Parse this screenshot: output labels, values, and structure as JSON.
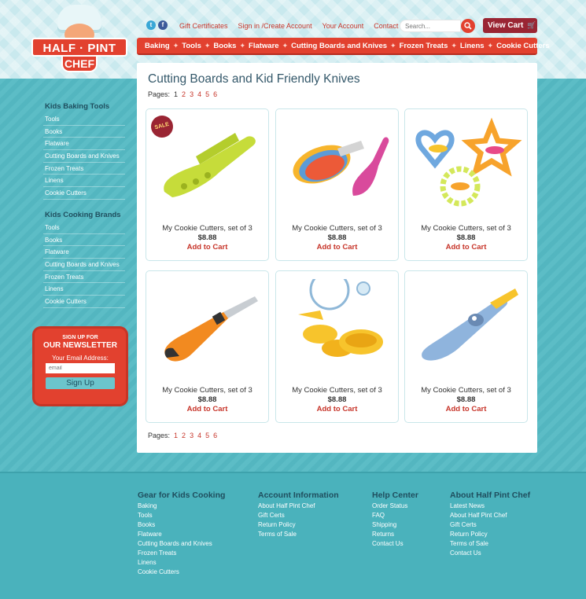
{
  "header": {
    "logo_line1": "HALF · PINT",
    "logo_line2": "CHEF",
    "social": {
      "twitter": "t",
      "facebook": "f"
    },
    "toplinks": [
      "Gift Certificates",
      "Sign in /Create Account",
      "Your Account",
      "Contact"
    ],
    "search_placeholder": "Search...",
    "cart_label": "View Cart"
  },
  "nav": [
    "Baking",
    "Tools",
    "Books",
    "Flatware",
    "Cutting Boards and Knives",
    "Frozen Treats",
    "Linens",
    "Cookie Cutters"
  ],
  "main": {
    "title": "Cutting Boards and Kid Friendly Knives",
    "pages_label": "Pages:",
    "pages": [
      "1",
      "2",
      "3",
      "4",
      "5",
      "6"
    ],
    "products": [
      {
        "name": "My Cookie Cutters, set of 3",
        "price": "$8.88",
        "add": "Add to Cart",
        "sale": "SALE"
      },
      {
        "name": "My Cookie Cutters, set of 3",
        "price": "$8.88",
        "add": "Add to Cart"
      },
      {
        "name": "My Cookie Cutters, set of 3",
        "price": "$8.88",
        "add": "Add to Cart"
      },
      {
        "name": "My Cookie Cutters, set of 3",
        "price": "$8.88",
        "add": "Add to Cart"
      },
      {
        "name": "My Cookie Cutters, set of 3",
        "price": "$8.88",
        "add": "Add to Cart"
      },
      {
        "name": "My Cookie Cutters, set of 3",
        "price": "$8.88",
        "add": "Add to Cart"
      }
    ]
  },
  "sidebar": {
    "tools_heading": "Kids Baking Tools",
    "tools": [
      "Tools",
      "Books",
      "Flatware",
      "Cutting Boards and Knives",
      "Frozen Treats",
      "Linens",
      "Cookie Cutters"
    ],
    "brands_heading": "Kids Cooking Brands",
    "brands": [
      "Tools",
      "Books",
      "Flatware",
      "Cutting Boards and Knives",
      "Frozen Treats",
      "Linens",
      "Cookie Cutters"
    ]
  },
  "newsletter": {
    "line1": "SIGN UP FOR",
    "line2": "OUR NEWSLETTER",
    "label": "Your Email Address:",
    "placeholder": "email",
    "button": "Sign Up"
  },
  "footer": [
    {
      "heading": "Gear for Kids Cooking",
      "items": [
        "Baking",
        "Tools",
        "Books",
        "Flatware",
        "Cutting Boards and Knives",
        "Frozen Treats",
        "Linens",
        "Cookie Cutters"
      ]
    },
    {
      "heading": "Account Information",
      "items": [
        "About Half Pint Chef",
        "Gift Certs",
        "Return Policy",
        "Terms of Sale"
      ]
    },
    {
      "heading": "Help Center",
      "items": [
        "Order Status",
        "FAQ",
        "Shipping",
        "Returns",
        "Contact Us"
      ]
    },
    {
      "heading": "About Half Pint Chef",
      "items": [
        "Latest News",
        "About Half Pint Chef",
        "Gift Certs",
        "Return Policy",
        "Terms of Sale",
        "Contact Us"
      ]
    }
  ],
  "colors": {
    "accent": "#e2412f",
    "cart": "#9a2533",
    "teal": "#55bac4"
  },
  "icons": {
    "search": "search-icon",
    "cart": "cart-icon"
  }
}
